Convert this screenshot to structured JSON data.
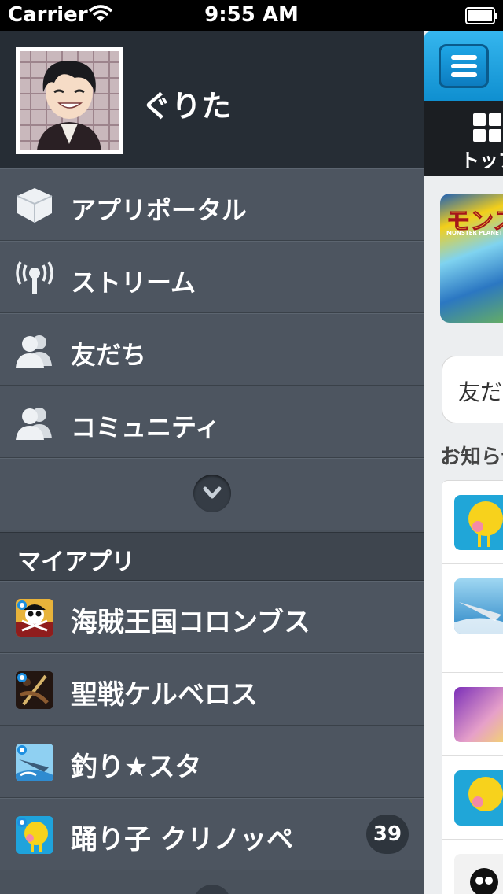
{
  "status_bar": {
    "carrier": "Carrier",
    "time": "9:55 AM",
    "icons": [
      "wifi-icon",
      "battery-icon"
    ]
  },
  "drawer": {
    "profile": {
      "username": "ぐりた",
      "avatar": "avatar"
    },
    "menu": [
      {
        "label": "アプリポータル",
        "icon": "cube-icon"
      },
      {
        "label": "ストリーム",
        "icon": "broadcast-icon"
      },
      {
        "label": "友だち",
        "icon": "people-icon"
      },
      {
        "label": "コミュニティ",
        "icon": "people-icon"
      }
    ],
    "expand_icon": "chevron-down-icon",
    "my_apps_header": "マイアプリ",
    "my_apps": [
      {
        "label": "海賊王国コロンブス",
        "icon": "pirate-app-icon",
        "badge": ""
      },
      {
        "label": "聖戦ケルベロス",
        "icon": "cerberus-app-icon",
        "badge": ""
      },
      {
        "label": "釣り★スタ",
        "icon": "fishing-app-icon",
        "badge": ""
      },
      {
        "label": "踊り子 クリノッペ",
        "icon": "kurinoppe-app-icon",
        "badge": "39"
      }
    ]
  },
  "main_panel": {
    "menu_button_icon": "hamburger-icon",
    "tab_label": "トップ",
    "banner_title": "モンスター",
    "banner_subtitle": "MONSTER PLANET",
    "friends_card_label": "友だち",
    "notices_label": "お知らせ"
  },
  "colors": {
    "drawer_bg": "#4d5560",
    "profile_bg": "#262d35",
    "accent_blue": "#1ba3e6",
    "badge_bg": "#2e353d"
  }
}
